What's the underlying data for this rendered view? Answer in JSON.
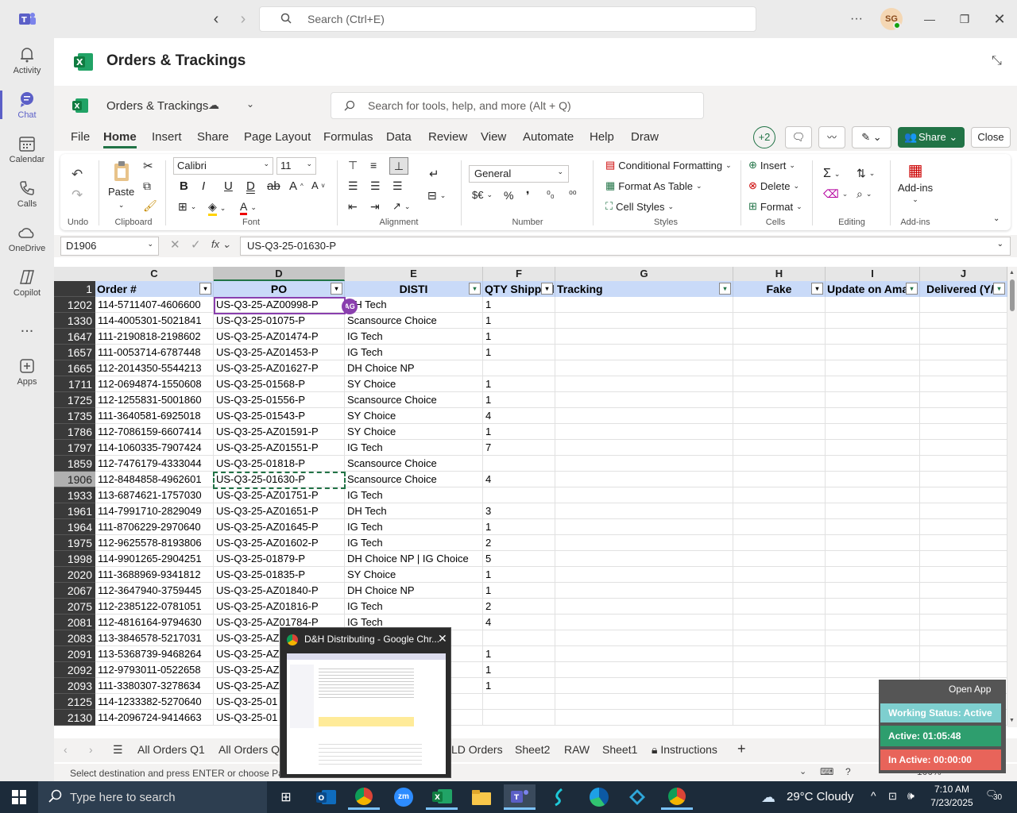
{
  "teams": {
    "search_placeholder": "Search (Ctrl+E)",
    "avatar": "SG",
    "rail": [
      {
        "label": "Activity"
      },
      {
        "label": "Chat"
      },
      {
        "label": "Calendar"
      },
      {
        "label": "Calls"
      },
      {
        "label": "OneDrive"
      },
      {
        "label": "Copilot"
      },
      {
        "label": "..."
      },
      {
        "label": "Apps"
      }
    ]
  },
  "page_title": "Orders & Trackings",
  "excel": {
    "doc_title": "Orders & Trackings",
    "search_placeholder": "Search for tools, help, and more (Alt + Q)",
    "menu": [
      "File",
      "Home",
      "Insert",
      "Share",
      "Page Layout",
      "Formulas",
      "Data",
      "Review",
      "View",
      "Automate",
      "Help",
      "Draw"
    ],
    "presence": "+2",
    "share": "Share",
    "close": "Close",
    "ribbon": {
      "font": "Calibri",
      "size": "11",
      "number_format": "General",
      "paste": "Paste",
      "groups": {
        "undo": "Undo",
        "clipboard": "Clipboard",
        "font": "Font",
        "alignment": "Alignment",
        "number": "Number",
        "styles": "Styles",
        "cells": "Cells",
        "editing": "Editing",
        "addins": "Add-ins"
      },
      "cond": "Conditional Formatting",
      "table": "Format As Table",
      "cellstyles": "Cell Styles",
      "insert": "Insert",
      "delete": "Delete",
      "format": "Format",
      "addins_btn": "Add-ins"
    },
    "namebox": "D1906",
    "formula": "US-Q3-25-01630-P",
    "columns": [
      "C",
      "D",
      "E",
      "F",
      "G",
      "H",
      "I",
      "J"
    ],
    "headers": [
      "Order #",
      "PO",
      "DISTI",
      "QTY Shipped",
      "Tracking",
      "Fake",
      "Update on Amaz",
      "Delivered (Y/N"
    ],
    "rows": [
      [
        "1202",
        "114-5711407-4606600",
        "US-Q3-25-AZ00998-P",
        "DH Tech",
        "1"
      ],
      [
        "1330",
        "114-4005301-5021841",
        "US-Q3-25-01075-P",
        "Scansource Choice",
        "1"
      ],
      [
        "1647",
        "111-2190818-2198602",
        "US-Q3-25-AZ01474-P",
        "IG Tech",
        "1"
      ],
      [
        "1657",
        "111-0053714-6787448",
        "US-Q3-25-AZ01453-P",
        "IG Tech",
        "1"
      ],
      [
        "1665",
        "112-2014350-5544213",
        "US-Q3-25-AZ01627-P",
        "DH Choice NP",
        ""
      ],
      [
        "1711",
        "112-0694874-1550608",
        "US-Q3-25-01568-P",
        "SY Choice",
        "1"
      ],
      [
        "1725",
        "112-1255831-5001860",
        "US-Q3-25-01556-P",
        "Scansource Choice",
        "1"
      ],
      [
        "1735",
        "111-3640581-6925018",
        "US-Q3-25-01543-P",
        "SY Choice",
        "4"
      ],
      [
        "1786",
        "112-7086159-6607414",
        "US-Q3-25-AZ01591-P",
        "SY Choice",
        "1"
      ],
      [
        "1797",
        "114-1060335-7907424",
        "US-Q3-25-AZ01551-P",
        "IG Tech",
        "7"
      ],
      [
        "1859",
        "112-7476179-4333044",
        "US-Q3-25-01818-P",
        "Scansource Choice",
        ""
      ],
      [
        "1906",
        "112-8484858-4962601",
        "US-Q3-25-01630-P",
        "Scansource Choice",
        "4"
      ],
      [
        "1933",
        "113-6874621-1757030",
        "US-Q3-25-AZ01751-P",
        "IG Tech",
        ""
      ],
      [
        "1961",
        "114-7991710-2829049",
        "US-Q3-25-AZ01651-P",
        "DH Tech",
        "3"
      ],
      [
        "1964",
        "111-8706229-2970640",
        "US-Q3-25-AZ01645-P",
        "IG Tech",
        "1"
      ],
      [
        "1975",
        "112-9625578-8193806",
        "US-Q3-25-AZ01602-P",
        "IG Tech",
        "2"
      ],
      [
        "1998",
        "114-9901265-2904251",
        "US-Q3-25-01879-P",
        "DH Choice NP | IG Choice",
        "5"
      ],
      [
        "2020",
        "111-3688969-9341812",
        "US-Q3-25-01835-P",
        "SY Choice",
        "1"
      ],
      [
        "2067",
        "112-3647940-3759445",
        "US-Q3-25-AZ01840-P",
        "DH Choice NP",
        "1"
      ],
      [
        "2075",
        "112-2385122-0781051",
        "US-Q3-25-AZ01816-P",
        "IG Tech",
        "2"
      ],
      [
        "2081",
        "112-4816164-9794630",
        "US-Q3-25-AZ01784-P",
        "IG Tech",
        "4"
      ],
      [
        "2083",
        "113-3846578-5217031",
        "US-Q3-25-AZ",
        "",
        ""
      ],
      [
        "2091",
        "113-5368739-9468264",
        "US-Q3-25-AZ",
        "",
        "1"
      ],
      [
        "2092",
        "112-9793011-0522658",
        "US-Q3-25-AZ",
        "",
        "1"
      ],
      [
        "2093",
        "111-3380307-3278634",
        "US-Q3-25-AZ",
        "",
        "1"
      ],
      [
        "2125",
        "114-1233382-5270640",
        "US-Q3-25-01",
        "",
        ""
      ],
      [
        "2130",
        "114-2096724-9414663",
        "US-Q3-25-01",
        "",
        ""
      ]
    ],
    "collab_badge": "AG",
    "tabs": [
      "All Orders Q1",
      "All Orders Q",
      "LD Orders",
      "Sheet2",
      "RAW",
      "Sheet1",
      "Instructions"
    ],
    "status": "Select destination and press ENTER or choose Pas",
    "zoom": "100%"
  },
  "preview": {
    "title": "D&H Distributing - Google Chr..."
  },
  "tracker": {
    "open": "Open App",
    "working": "Working Status: Active",
    "active": "Active: 01:05:48",
    "inactive": "In Active: 00:00:00"
  },
  "taskbar": {
    "search_placeholder": "Type here to search",
    "weather": "29°C  Cloudy",
    "time": "7:10 AM",
    "date": "7/23/2025",
    "notif": "30"
  },
  "colors": {
    "excel_green": "#217346",
    "header_fill": "#c9daf8",
    "teams_purple": "#5b5fc7"
  }
}
